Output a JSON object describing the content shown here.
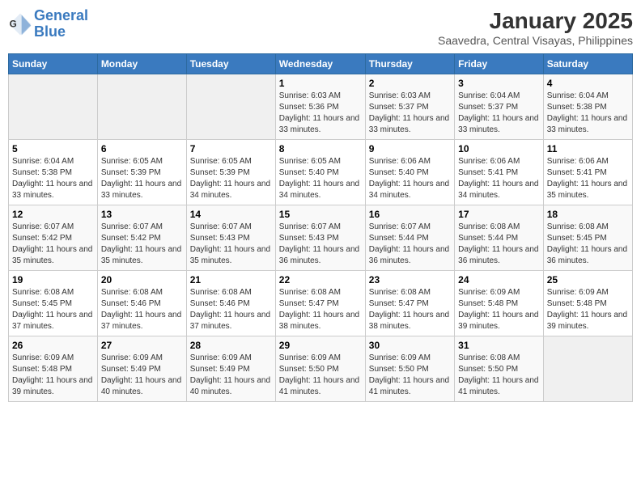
{
  "logo": {
    "line1": "General",
    "line2": "Blue"
  },
  "title": "January 2025",
  "subtitle": "Saavedra, Central Visayas, Philippines",
  "weekdays": [
    "Sunday",
    "Monday",
    "Tuesday",
    "Wednesday",
    "Thursday",
    "Friday",
    "Saturday"
  ],
  "weeks": [
    [
      {
        "day": "",
        "sunrise": "",
        "sunset": "",
        "daylight": ""
      },
      {
        "day": "",
        "sunrise": "",
        "sunset": "",
        "daylight": ""
      },
      {
        "day": "",
        "sunrise": "",
        "sunset": "",
        "daylight": ""
      },
      {
        "day": "1",
        "sunrise": "6:03 AM",
        "sunset": "5:36 PM",
        "daylight": "11 hours and 33 minutes."
      },
      {
        "day": "2",
        "sunrise": "6:03 AM",
        "sunset": "5:37 PM",
        "daylight": "11 hours and 33 minutes."
      },
      {
        "day": "3",
        "sunrise": "6:04 AM",
        "sunset": "5:37 PM",
        "daylight": "11 hours and 33 minutes."
      },
      {
        "day": "4",
        "sunrise": "6:04 AM",
        "sunset": "5:38 PM",
        "daylight": "11 hours and 33 minutes."
      }
    ],
    [
      {
        "day": "5",
        "sunrise": "6:04 AM",
        "sunset": "5:38 PM",
        "daylight": "11 hours and 33 minutes."
      },
      {
        "day": "6",
        "sunrise": "6:05 AM",
        "sunset": "5:39 PM",
        "daylight": "11 hours and 33 minutes."
      },
      {
        "day": "7",
        "sunrise": "6:05 AM",
        "sunset": "5:39 PM",
        "daylight": "11 hours and 34 minutes."
      },
      {
        "day": "8",
        "sunrise": "6:05 AM",
        "sunset": "5:40 PM",
        "daylight": "11 hours and 34 minutes."
      },
      {
        "day": "9",
        "sunrise": "6:06 AM",
        "sunset": "5:40 PM",
        "daylight": "11 hours and 34 minutes."
      },
      {
        "day": "10",
        "sunrise": "6:06 AM",
        "sunset": "5:41 PM",
        "daylight": "11 hours and 34 minutes."
      },
      {
        "day": "11",
        "sunrise": "6:06 AM",
        "sunset": "5:41 PM",
        "daylight": "11 hours and 35 minutes."
      }
    ],
    [
      {
        "day": "12",
        "sunrise": "6:07 AM",
        "sunset": "5:42 PM",
        "daylight": "11 hours and 35 minutes."
      },
      {
        "day": "13",
        "sunrise": "6:07 AM",
        "sunset": "5:42 PM",
        "daylight": "11 hours and 35 minutes."
      },
      {
        "day": "14",
        "sunrise": "6:07 AM",
        "sunset": "5:43 PM",
        "daylight": "11 hours and 35 minutes."
      },
      {
        "day": "15",
        "sunrise": "6:07 AM",
        "sunset": "5:43 PM",
        "daylight": "11 hours and 36 minutes."
      },
      {
        "day": "16",
        "sunrise": "6:07 AM",
        "sunset": "5:44 PM",
        "daylight": "11 hours and 36 minutes."
      },
      {
        "day": "17",
        "sunrise": "6:08 AM",
        "sunset": "5:44 PM",
        "daylight": "11 hours and 36 minutes."
      },
      {
        "day": "18",
        "sunrise": "6:08 AM",
        "sunset": "5:45 PM",
        "daylight": "11 hours and 36 minutes."
      }
    ],
    [
      {
        "day": "19",
        "sunrise": "6:08 AM",
        "sunset": "5:45 PM",
        "daylight": "11 hours and 37 minutes."
      },
      {
        "day": "20",
        "sunrise": "6:08 AM",
        "sunset": "5:46 PM",
        "daylight": "11 hours and 37 minutes."
      },
      {
        "day": "21",
        "sunrise": "6:08 AM",
        "sunset": "5:46 PM",
        "daylight": "11 hours and 37 minutes."
      },
      {
        "day": "22",
        "sunrise": "6:08 AM",
        "sunset": "5:47 PM",
        "daylight": "11 hours and 38 minutes."
      },
      {
        "day": "23",
        "sunrise": "6:08 AM",
        "sunset": "5:47 PM",
        "daylight": "11 hours and 38 minutes."
      },
      {
        "day": "24",
        "sunrise": "6:09 AM",
        "sunset": "5:48 PM",
        "daylight": "11 hours and 39 minutes."
      },
      {
        "day": "25",
        "sunrise": "6:09 AM",
        "sunset": "5:48 PM",
        "daylight": "11 hours and 39 minutes."
      }
    ],
    [
      {
        "day": "26",
        "sunrise": "6:09 AM",
        "sunset": "5:48 PM",
        "daylight": "11 hours and 39 minutes."
      },
      {
        "day": "27",
        "sunrise": "6:09 AM",
        "sunset": "5:49 PM",
        "daylight": "11 hours and 40 minutes."
      },
      {
        "day": "28",
        "sunrise": "6:09 AM",
        "sunset": "5:49 PM",
        "daylight": "11 hours and 40 minutes."
      },
      {
        "day": "29",
        "sunrise": "6:09 AM",
        "sunset": "5:50 PM",
        "daylight": "11 hours and 41 minutes."
      },
      {
        "day": "30",
        "sunrise": "6:09 AM",
        "sunset": "5:50 PM",
        "daylight": "11 hours and 41 minutes."
      },
      {
        "day": "31",
        "sunrise": "6:08 AM",
        "sunset": "5:50 PM",
        "daylight": "11 hours and 41 minutes."
      },
      {
        "day": "",
        "sunrise": "",
        "sunset": "",
        "daylight": ""
      }
    ]
  ],
  "labels": {
    "sunrise": "Sunrise:",
    "sunset": "Sunset:",
    "daylight": "Daylight:"
  }
}
